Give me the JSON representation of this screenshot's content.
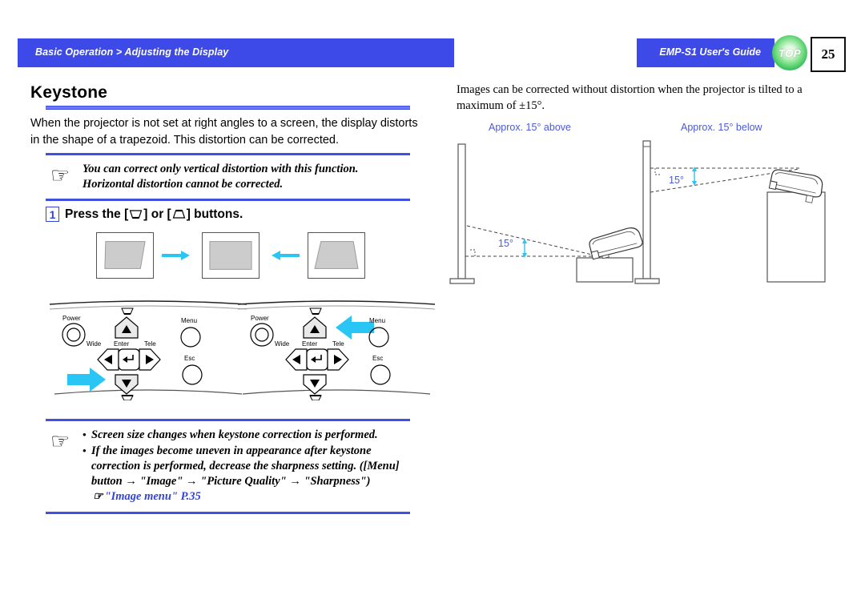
{
  "header": {
    "breadcrumb": "Basic Operation > Adjusting the Display",
    "guide_title": "EMP-S1 User's Guide",
    "top_badge": "TOP",
    "page_number": "25",
    "bar_color": "#3d4ae8",
    "badge_color": "#35c05a"
  },
  "left": {
    "section_title": "Keystone",
    "intro": "When the projector is not set at right angles to a screen, the display distorts in the shape of a trapezoid. This distortion can be corrected.",
    "note_1": "You can correct only vertical distortion with this function. Horizontal distortion cannot be corrected.",
    "step": {
      "number": "1",
      "text_before": "Press the [",
      "text_middle": "] or [",
      "text_after": "] buttons.",
      "icon_1": "keystone-down-icon",
      "icon_2": "keystone-up-icon"
    },
    "note_2": {
      "bullet_1": "Screen size changes when keystone correction is performed.",
      "bullet_2_part1": "If the images become uneven in appearance after keystone correction is performed,  decrease the sharpness setting. ([Menu] button ",
      "arrow": "→",
      "bullet_2_part2": " \"Image\" ",
      "bullet_2_part3": " \"Picture Quality\" ",
      "bullet_2_part4": " \"Sharpness\")",
      "link_text": "\"Image menu\" P.35",
      "link_color": "#3344dd"
    },
    "panel_buttons": {
      "power": "Power",
      "wide": "Wide",
      "enter": "Enter",
      "tele": "Tele",
      "menu": "Menu",
      "esc": "Esc"
    },
    "arrow_color": "#29c5f5"
  },
  "right": {
    "intro": "Images can be corrected without distortion when the projector is tilted to a maximum of ±15°.",
    "label_above": "Approx. 15° above",
    "label_below": "Approx. 15° below",
    "angle_left": "15°",
    "angle_right": "15°",
    "label_color": "#4a5ad8",
    "dim_arrow_color": "#29c5f5"
  }
}
